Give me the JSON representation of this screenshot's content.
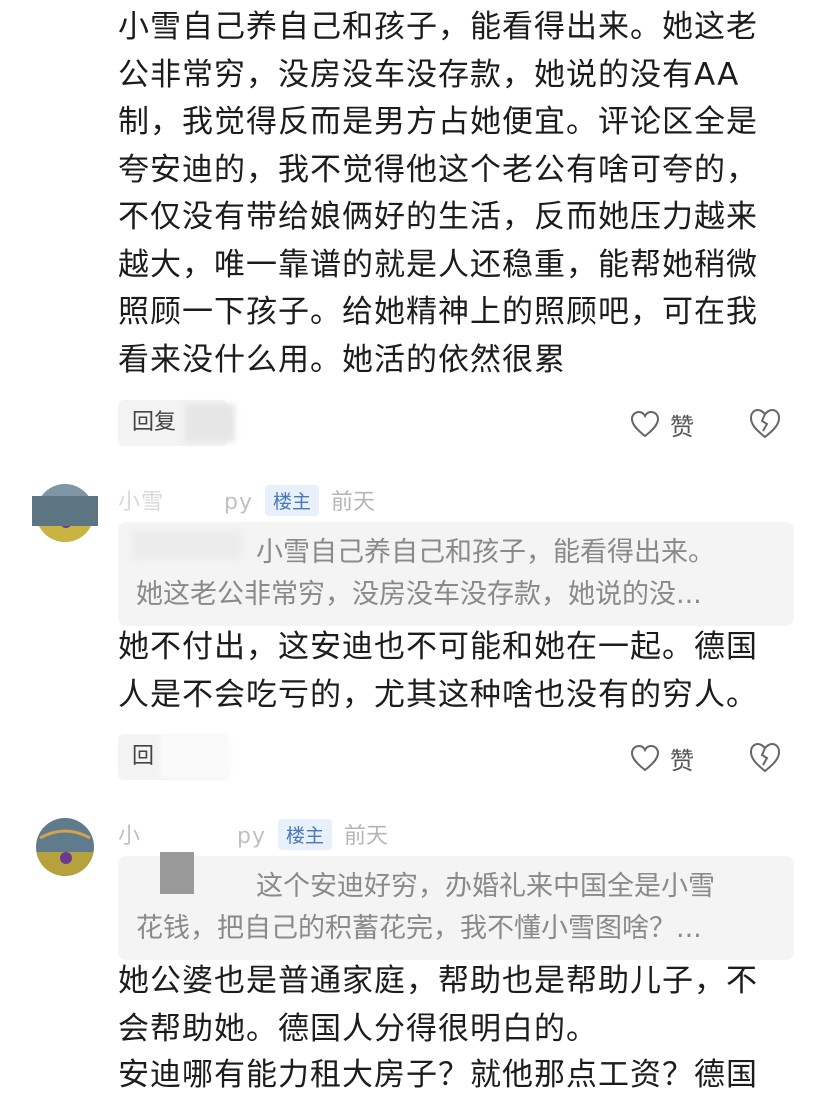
{
  "comment1": {
    "text": "小雪自己养自己和孩子，能看得出来。她这老公非常穷，没房没车没存款，她说的没有AA制，我觉得反而是男方占她便宜。评论区全是夸安迪的，我不觉得他这个老公有啥可夸的，不仅没有带给娘俩好的生活，反而她压力越来越大，唯一靠谱的就是人还稳重，能帮她稍微照顾一下孩子。给她精神上的照顾吧，可在我看来没什么用。她活的依然很累",
    "reply_label": "回复",
    "like_label": "赞"
  },
  "reply1": {
    "username": "小雪",
    "username_suffix": "py",
    "badge": "楼主",
    "time": "前天",
    "quote_line1": "小雪自己养自己和孩子，能看得出来。",
    "quote_line2": "她这老公非常穷，没房没车没存款，她说的没...",
    "text": "她不付出，这安迪也不可能和她在一起。德国人是不会吃亏的，尤其这种啥也没有的穷人。",
    "reply_label": "回",
    "like_label": "赞"
  },
  "reply2": {
    "username": "小",
    "username_suffix": "py",
    "badge": "楼主",
    "time": "前天",
    "quote_line1": "这个安迪好穷，办婚礼来中国全是小雪",
    "quote_line2": "花钱，把自己的积蓄花完，我不懂小雪图啥？...",
    "text_line1": "她公婆也是普通家庭，帮助也是帮助儿子，不会帮助她。德国人分得很明白的。",
    "text_line2": "安迪哪有能力租大房子？就他那点工资？德国"
  },
  "icons": {
    "like": "heart-outline-icon",
    "dislike": "broken-heart-icon"
  },
  "colors": {
    "badge_bg": "#e7f0fb",
    "badge_text": "#4a78b8",
    "quote_bg": "#f4f4f4"
  }
}
